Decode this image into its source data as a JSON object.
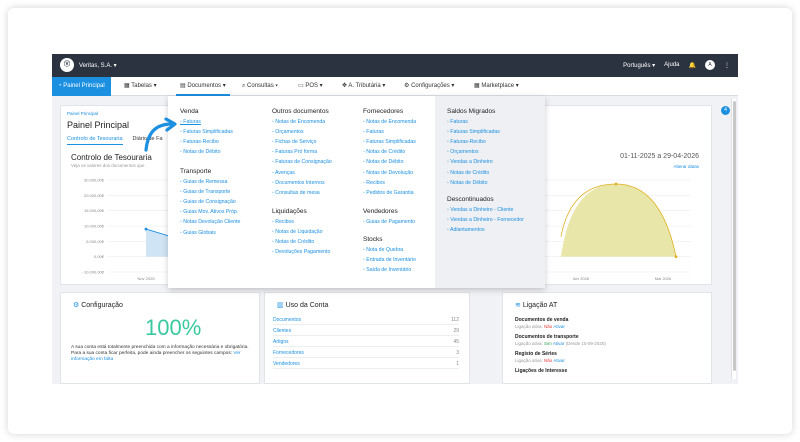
{
  "topbar": {
    "company": "Veritas, S.A.",
    "language": "Português",
    "help": "Ajuda",
    "avatar_initial": "A"
  },
  "navbar": {
    "items": [
      {
        "label": "Painel Principal",
        "icon": "gauge-icon"
      },
      {
        "label": "Tabelas",
        "icon": "table-icon"
      },
      {
        "label": "Documentos",
        "icon": "document-icon"
      },
      {
        "label": "Consultas",
        "icon": "search-icon"
      },
      {
        "label": "POS",
        "icon": "pos-icon"
      },
      {
        "label": "A. Tributária",
        "icon": "tax-icon"
      },
      {
        "label": "Configurações",
        "icon": "gear-icon"
      },
      {
        "label": "Marketplace",
        "icon": "grid-icon"
      }
    ]
  },
  "main": {
    "breadcrumb": "Painel Principal",
    "title": "Painel Principal",
    "tabs": [
      "Controlo de Tesouraria",
      "Diário de Fa"
    ],
    "badge": "4"
  },
  "chart_data": {
    "type": "area",
    "title": "Controlo de Tesouraria",
    "subtitle": "Veja os valores dos documentos que",
    "range": "01-11-2025 a 29-04-2026",
    "change_label": "Alterar datas",
    "y_ticks": [
      "30.000,00€",
      "20.000,00€",
      "15.000,00€",
      "10.000,00€",
      "5.000,00€",
      "0,00€",
      "-10.000,00€"
    ],
    "x_ticks": [
      "Nov 2025",
      "Abr 2026",
      "Mai 2026"
    ],
    "series": [
      {
        "values": [
          10000,
          2000
        ]
      },
      {
        "values": [
          28000,
          0
        ]
      }
    ],
    "colors": {
      "area_blue": "#cfe4f5",
      "area_yellow": "#e8e6a8",
      "line_yellow": "#e0b020",
      "line_blue": "#1b8fe0"
    }
  },
  "config_card": {
    "title": "Configuração",
    "percent": "100%",
    "text1": "A sua conta está totalmente preenchida com a informação necessária e obrigatória.",
    "text2": "Para a sua conta ficar perfeita, pode ainda preencher os seguintes campos:",
    "link": "Ver informação em falta"
  },
  "usage_card": {
    "title": "Uso da Conta",
    "rows": [
      {
        "label": "Documentos",
        "value": "112"
      },
      {
        "label": "Clientes",
        "value": "29"
      },
      {
        "label": "Artigos",
        "value": "45"
      },
      {
        "label": "Fornecedores",
        "value": "3"
      },
      {
        "label": "Vendedores",
        "value": "1"
      }
    ]
  },
  "at_card": {
    "title": "Ligação AT",
    "items": [
      {
        "title": "Documentos de venda",
        "status_label": "Ligação ativa:",
        "status": "Não",
        "action": "Ativar",
        "extra": ""
      },
      {
        "title": "Documentos de transporte",
        "status_label": "Ligação ativa:",
        "status": "Sim",
        "action": "Ativar",
        "extra": "(Desde 10-09-2025)"
      },
      {
        "title": "Registo de Séries",
        "status_label": "Ligação ativa:",
        "status": "Não",
        "action": "Ativar",
        "extra": ""
      },
      {
        "title": "Ligações de Interesse",
        "status_label": "",
        "status": "",
        "action": "",
        "extra": ""
      }
    ]
  },
  "mega_menu": {
    "venda": {
      "title": "Venda",
      "items": [
        "Faturas",
        "Faturas Simplificadas",
        "Faturas-Recibo",
        "Notas de Débito"
      ]
    },
    "transporte": {
      "title": "Transporte",
      "items": [
        "Guias de Remessa",
        "Guias de Transporte",
        "Guias de Consignação",
        "Guias Mov. Ativos Próp.",
        "Notas Devolução Cliente",
        "Guias Globais"
      ]
    },
    "outros": {
      "title": "Outros documentos",
      "items": [
        "Notas de Encomenda",
        "Orçamentos",
        "Fichas de Serviço",
        "Faturas Pró forma",
        "Faturas de Consignação",
        "Avenças",
        "Documentos Internos",
        "Consultas de mesa"
      ]
    },
    "liquidacoes": {
      "title": "Liquidações",
      "items": [
        "Recibos",
        "Notas de Liquidação",
        "Notas de Crédito",
        "Devoluções Pagamento"
      ]
    },
    "fornecedores": {
      "title": "Fornecedores",
      "items": [
        "Notas de Encomenda",
        "Faturas",
        "Faturas Simplificadas",
        "Notas de Crédito",
        "Notas de Débito",
        "Notas de Devolução",
        "Recibos",
        "Pedidos de Garantia"
      ]
    },
    "vendedores": {
      "title": "Vendedores",
      "items": [
        "Guias de Pagamento"
      ]
    },
    "stocks": {
      "title": "Stocks",
      "items": [
        "Nota de Quebra",
        "Entrada de Inventário",
        "Saída de Inventário"
      ]
    },
    "saldos": {
      "title": "Saldos Migrados",
      "items": [
        "Faturas",
        "Faturas Simplificadas",
        "Faturas-Recibo",
        "Orçamentos",
        "Vendas a Dinheiro",
        "Notas de Crédito",
        "Notas de Débito"
      ]
    },
    "descontinuados": {
      "title": "Descontinuados",
      "items": [
        "Vendas a Dinheiro - Cliente",
        "Vendas a Dinheiro - Fornecedor",
        "Adiantamentos"
      ]
    }
  }
}
